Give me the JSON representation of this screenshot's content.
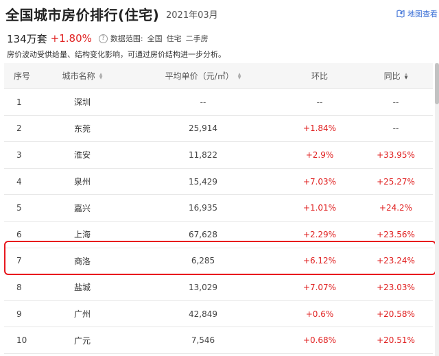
{
  "header": {
    "title": "全国城市房价排行(住宅)",
    "date": "2021年03月",
    "map_link": "地图查看"
  },
  "summary": {
    "price": "134万套",
    "change": "+1.80%",
    "help_glyph": "?",
    "range_label": "数据范围:",
    "range_options": [
      "全国",
      "住宅",
      "二手房"
    ]
  },
  "note": "房价波动受供给量、结构变化影响，可通过房价结构进一步分析。",
  "table": {
    "headers": {
      "rank": "序号",
      "city": "城市名称",
      "price": "平均单价（元/㎡）",
      "mom": "环比",
      "yoy": "同比"
    },
    "rows": [
      {
        "rank": "1",
        "city": "深圳",
        "price": "--",
        "mom": "--",
        "yoy": "--"
      },
      {
        "rank": "2",
        "city": "东莞",
        "price": "25,914",
        "mom": "+1.84%",
        "yoy": "--"
      },
      {
        "rank": "3",
        "city": "淮安",
        "price": "11,822",
        "mom": "+2.9%",
        "yoy": "+33.95%"
      },
      {
        "rank": "4",
        "city": "泉州",
        "price": "15,429",
        "mom": "+7.03%",
        "yoy": "+25.27%"
      },
      {
        "rank": "5",
        "city": "嘉兴",
        "price": "16,935",
        "mom": "+1.01%",
        "yoy": "+24.2%"
      },
      {
        "rank": "6",
        "city": "上海",
        "price": "67,628",
        "mom": "+2.29%",
        "yoy": "+23.56%"
      },
      {
        "rank": "7",
        "city": "商洛",
        "price": "6,285",
        "mom": "+6.12%",
        "yoy": "+23.24%"
      },
      {
        "rank": "8",
        "city": "盐城",
        "price": "13,029",
        "mom": "+7.07%",
        "yoy": "+23.03%"
      },
      {
        "rank": "9",
        "city": "广州",
        "price": "42,849",
        "mom": "+0.6%",
        "yoy": "+20.58%"
      },
      {
        "rank": "10",
        "city": "广元",
        "price": "7,546",
        "mom": "+0.68%",
        "yoy": "+20.51%"
      }
    ]
  },
  "colors": {
    "positive": "#e02020",
    "highlight": "#e8171d",
    "link": "#3b6fd6"
  }
}
